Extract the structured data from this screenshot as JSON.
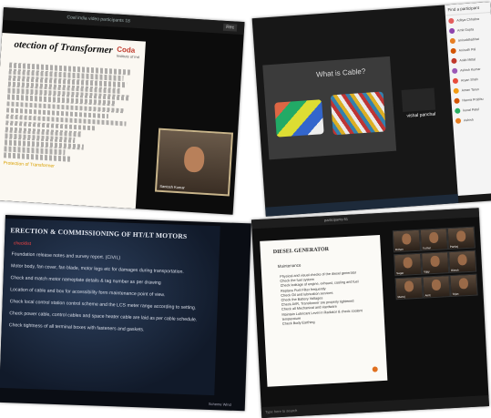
{
  "shot1": {
    "window_title": "Coal india video participants 18",
    "rec_label": "Rec",
    "slide_title": "otection of Transformer",
    "logo": "Coda",
    "logo_sub": "Institute of Ind",
    "lines_count_hint": "",
    "highlight": "Protection of Transformer",
    "presenter": "Santosh Kumar"
  },
  "shot2": {
    "slide_title": "What is Cable?",
    "presenter_name": "vishal panchal",
    "panel_header": "Find a participant",
    "participants": [
      {
        "name": "Aditya Chhabra",
        "color": "#e35d5d"
      },
      {
        "name": "Amit Gupta",
        "color": "#8e44ad"
      },
      {
        "name": "aniruddhabhat",
        "color": "#e67e22"
      },
      {
        "name": "Anirudh Pal",
        "color": "#d35400"
      },
      {
        "name": "Ankit Mittal",
        "color": "#c0392b"
      },
      {
        "name": "Ashish Kumar",
        "color": "#9b59b6"
      },
      {
        "name": "Aryan Shah",
        "color": "#e74c3c"
      },
      {
        "name": "Aman Tarun",
        "color": "#f39c12"
      },
      {
        "name": "Hanna Prabhu",
        "color": "#d35400"
      },
      {
        "name": "kunal Patel",
        "color": "#27ae60"
      },
      {
        "name": "Ashish",
        "color": "#e67e22"
      }
    ]
  },
  "shot3": {
    "slide_title": "ERECTION & COMMISSIONING OF HT/LT MOTORS",
    "subtitle": "checklist",
    "items": [
      "Foundation release notes and survey report. (CIVIL)",
      "Motor body, fan cover, fan blade, motor legs etc for damages during transportation.",
      "Check and match motor nameplate details & tag number as per drawing",
      "Location of cable and box for accessibility form maintenance point of view.",
      "Check local control station control scheme and the LCS meter range according to setting.",
      "Check power cable, control cables and space heater cable are laid as per cable schedule.",
      "Check tightness of all terminal boxes with fasteners and gaskets."
    ],
    "footer": "Scheme Wind"
  },
  "shot4": {
    "window_title": "participants 61",
    "slide_title": "DIESEL GENERATOR",
    "subtitle": "Maintenance",
    "checklist": [
      "Physical and visual checks of the diesel generator",
      "Check the fuel system",
      "Check leakage of engine, exhaust, cooling and fuel",
      "Replace Fuel Filter frequently",
      "Check Oil and lubrication services",
      "Check the Battery Voltages",
      "Check AVR, Transformer are properly tightened",
      "Check all Mechanical and Hardware",
      "Maintain Lubricant Level in Radiator & check coolant temperature",
      "Check Body Earthing"
    ],
    "tiles": [
      {
        "label": "Rohan"
      },
      {
        "label": "Tushar"
      },
      {
        "label": "Pankaj"
      },
      {
        "label": "Sagar"
      },
      {
        "label": "Vijay"
      },
      {
        "label": "Ritesh"
      },
      {
        "label": "Manoj"
      },
      {
        "label": "Amit"
      },
      {
        "label": "Tejas"
      }
    ],
    "bottom_text": "Type here to search"
  }
}
